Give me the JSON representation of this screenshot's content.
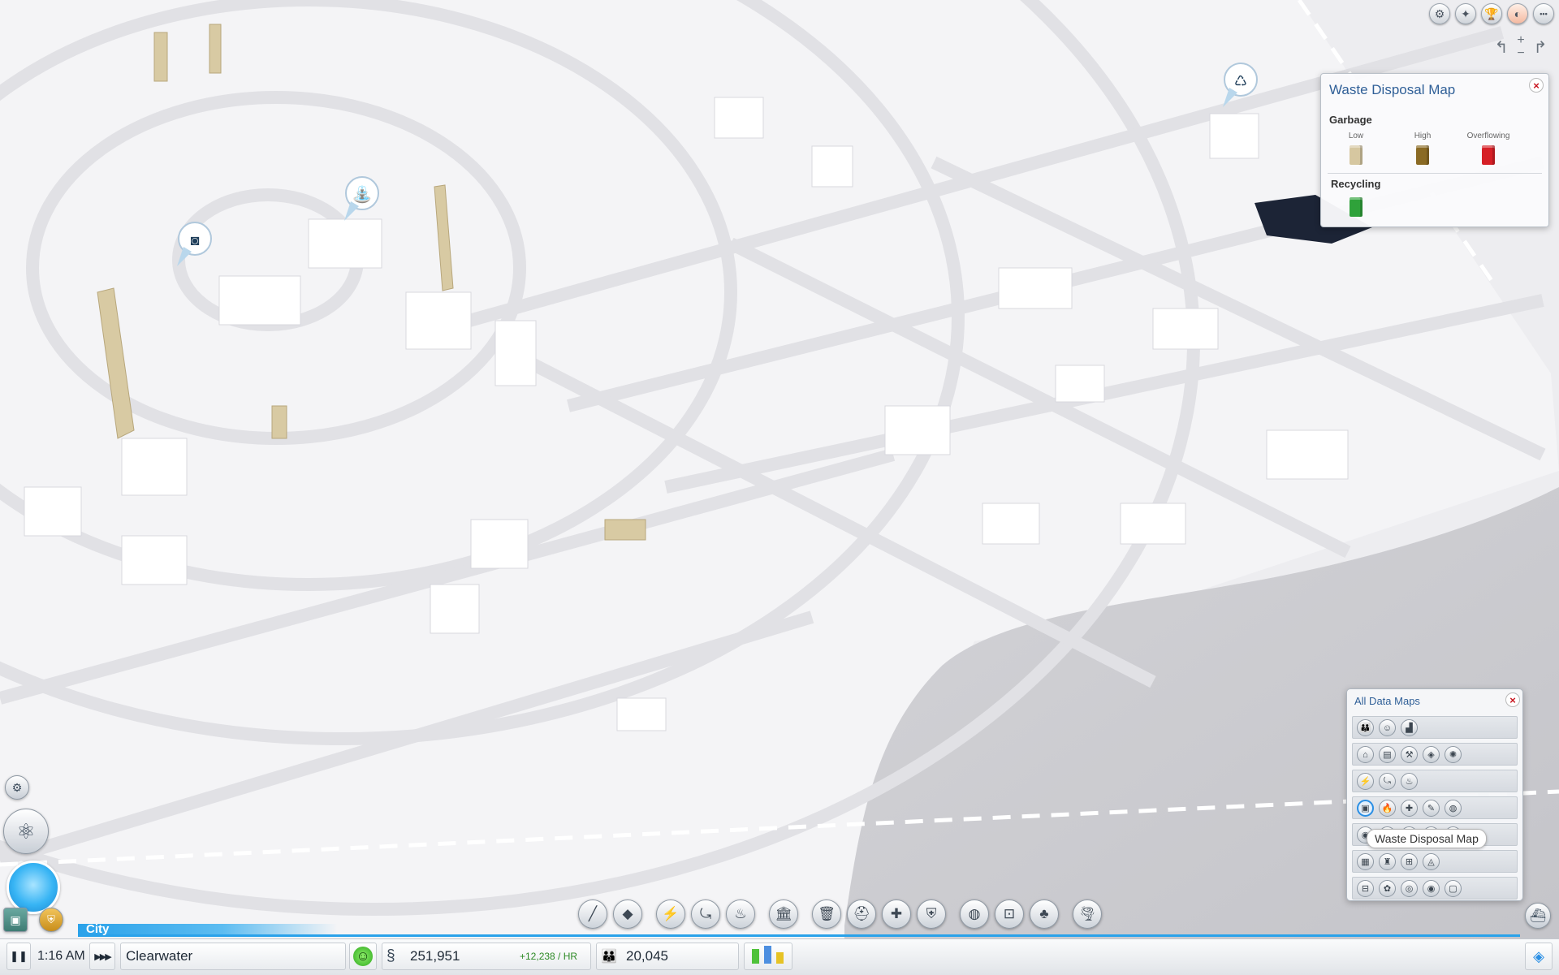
{
  "waste_map": {
    "title": "Waste Disposal Map",
    "garbage_label": "Garbage",
    "levels": [
      {
        "label": "Low",
        "color": "#d6c7a0"
      },
      {
        "label": "High",
        "color": "#8a6a24"
      },
      {
        "label": "Overflowing",
        "color": "#d61f26"
      }
    ],
    "recycling_label": "Recycling",
    "recycling_color": "#2fa23a",
    "close_icon": "×"
  },
  "data_maps": {
    "title": "All Data Maps",
    "close_icon": "×",
    "tooltip": "Waste Disposal Map",
    "rows": [
      [
        "👪",
        "☺",
        "▟"
      ],
      [
        "⌂",
        "▤",
        "⚒",
        "◈",
        "✺"
      ],
      [
        "⚡",
        "⤿",
        "♨"
      ],
      [
        "▣",
        "🔥",
        "✚",
        "✎",
        "◍"
      ],
      [
        "◉",
        "◌",
        "◔",
        "◗",
        "◆"
      ],
      [
        "▦",
        "♜",
        "⊞",
        "◬"
      ],
      [
        "⊟",
        "✿",
        "◎",
        "◉",
        "▢"
      ]
    ]
  },
  "toolbar": {
    "groups": [
      [
        "╱",
        "◆"
      ],
      [
        "⚡",
        "⤿",
        "♨"
      ],
      [
        "🏛"
      ],
      [
        "🗑",
        "⛑",
        "✚",
        "⛨"
      ],
      [
        "◍",
        "⊡",
        "♣"
      ],
      [
        "🌪"
      ]
    ]
  },
  "top_right": {
    "buttons": [
      "⚙",
      "✦",
      "🏆",
      "◐",
      "•••"
    ],
    "camera_controls": [
      "↰",
      "+",
      "−",
      "↱"
    ]
  },
  "status": {
    "city_mode_label": "City",
    "pause_icon": "❚❚",
    "time": "1:16 AM",
    "speed_icon": "▶▶▶",
    "city_name": "Clearwater",
    "happiness_icon": "☺",
    "money_icon": "§",
    "money": "251,951",
    "income": "+12,238 / HR",
    "population_icon": "👪",
    "population": "20,045",
    "rci": {
      "residential": 0.7,
      "commercial": 0.85,
      "industrial": 0.55
    },
    "layers_icon": "◈",
    "region_icon": "⛴"
  },
  "map_markers": [
    "🚰",
    "📷",
    "♻"
  ]
}
